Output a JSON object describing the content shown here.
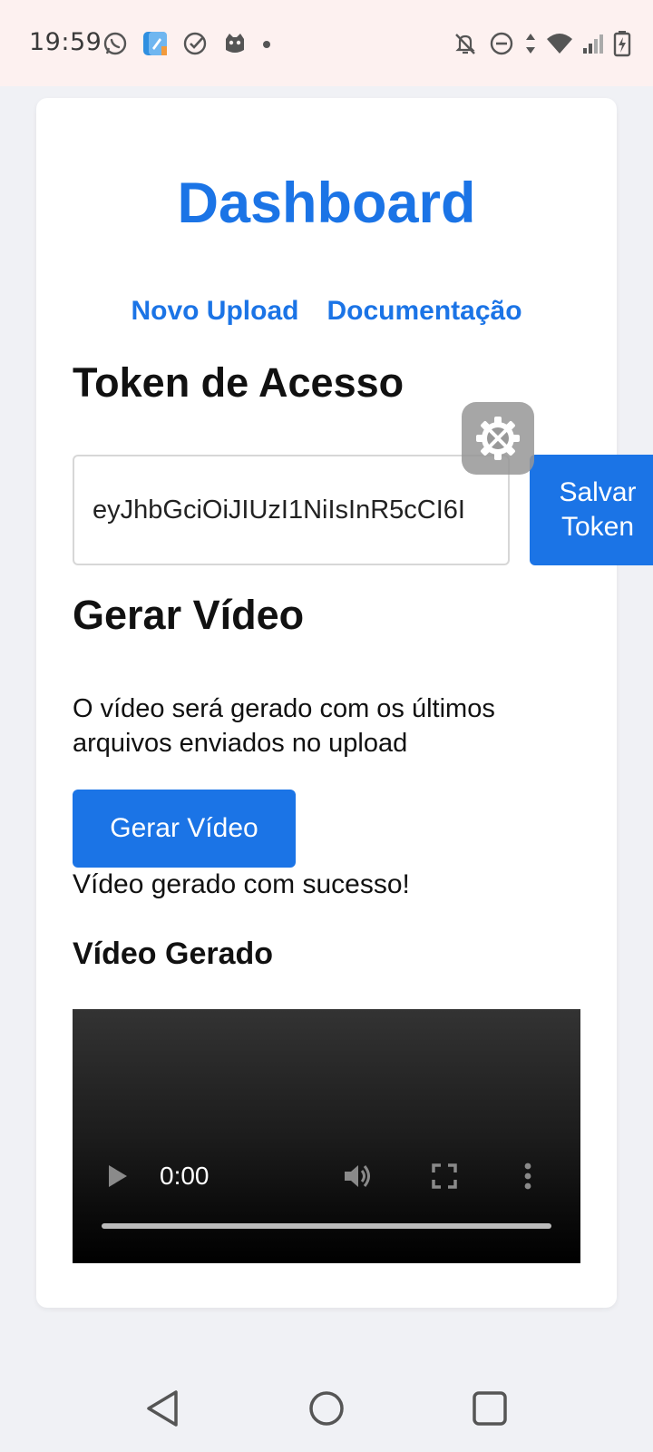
{
  "status_bar": {
    "time": "19:59",
    "left_icons": [
      "whatsapp-icon",
      "notes-app-icon",
      "check-circle-icon",
      "mascot-app-icon",
      "dot-icon"
    ],
    "right_icons": [
      "notifications-off-icon",
      "do-not-disturb-icon",
      "data-arrows-icon",
      "wifi-icon",
      "cellular-signal-icon",
      "battery-charging-icon"
    ]
  },
  "page": {
    "title": "Dashboard",
    "nav": {
      "new_upload": "Novo Upload",
      "docs": "Documentação"
    },
    "token_section": {
      "heading": "Token de Acesso",
      "input_value": "eyJhbGciOiJIUzI1NiIsInR5cCI6I",
      "save_label": "Salvar\nToken"
    },
    "video_section": {
      "heading": "Gerar Vídeo",
      "description": "O vídeo será gerado com os últimos arquivos enviados no upload",
      "button_label": "Gerar Vídeo",
      "success_message": "Vídeo gerado com sucesso!",
      "result_heading": "Vídeo Gerado",
      "player_time": "0:00"
    }
  },
  "floating_tool_icon": "settings-tools-icon",
  "colors": {
    "accent": "#1b74e6",
    "status_bar_bg": "#fdf1f0",
    "page_bg": "#f0f1f5"
  }
}
